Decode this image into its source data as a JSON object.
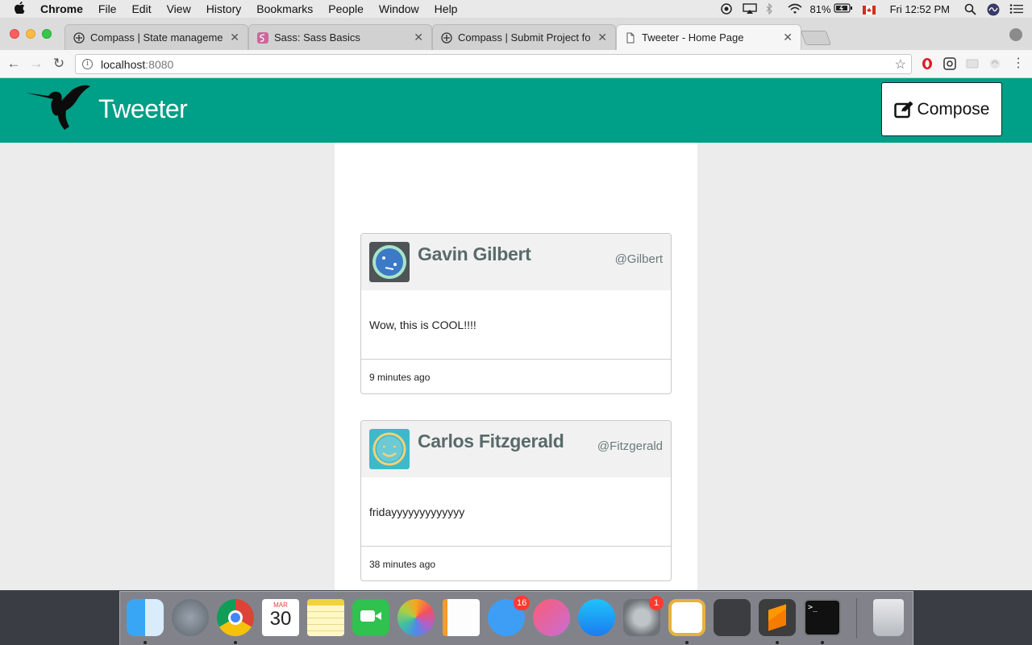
{
  "menubar": {
    "app_name": "Chrome",
    "menus": [
      "File",
      "Edit",
      "View",
      "History",
      "Bookmarks",
      "People",
      "Window",
      "Help"
    ],
    "battery": "81%",
    "clock": "Fri 12:52 PM"
  },
  "browser": {
    "tabs": [
      {
        "title": "Compass | State management"
      },
      {
        "title": "Sass: Sass Basics"
      },
      {
        "title": "Compass | Submit Project for E"
      },
      {
        "title": "Tweeter - Home Page"
      }
    ],
    "url_host": "localhost",
    "url_port": ":8080"
  },
  "app": {
    "brand": "Tweeter",
    "compose_label": "Compose",
    "accent_color": "#009f87"
  },
  "tweets": [
    {
      "name": "Gavin Gilbert",
      "handle": "@Gilbert",
      "text": "Wow, this is COOL!!!!",
      "time": "9 minutes ago"
    },
    {
      "name": "Carlos Fitzgerald",
      "handle": "@Fitzgerald",
      "text": "fridayyyyyyyyyyyyy",
      "time": "38 minutes ago"
    }
  ],
  "dock": {
    "calendar_month": "MAR",
    "calendar_day": "30",
    "messages_badge": "16",
    "settings_badge": "1"
  }
}
